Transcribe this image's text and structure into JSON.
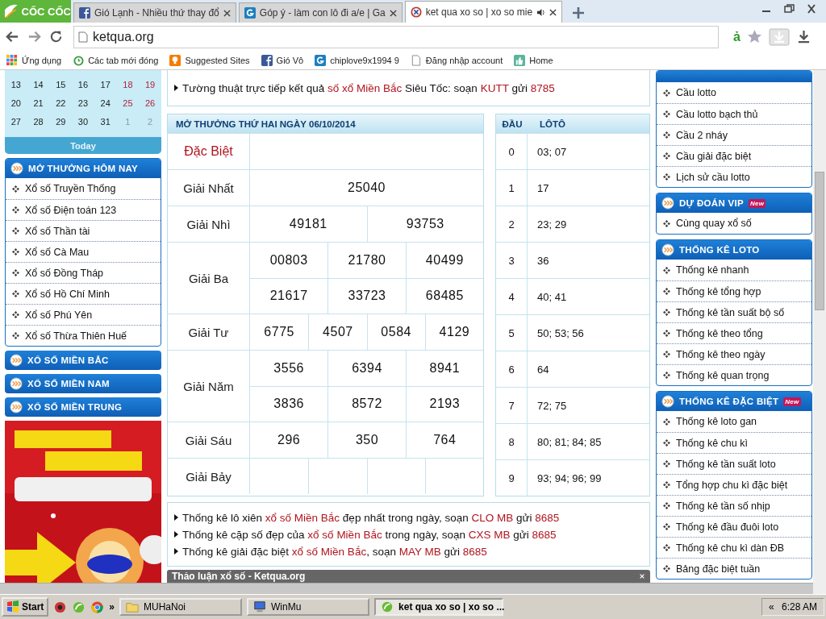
{
  "browser": {
    "logo": "CỐC CỐC",
    "tabs": [
      {
        "title": "Gió Lạnh - Nhiều thứ thay đổ",
        "selected": false,
        "audio": false
      },
      {
        "title": "Góp ý - làm con lô đi a/e | Ga",
        "selected": false,
        "audio": false
      },
      {
        "title": "ket qua xo so | xo so mie",
        "selected": true,
        "audio": true
      }
    ],
    "address": "ketqua.org",
    "extension": "ả",
    "bookmarks": [
      "Ứng dụng",
      "Các tab mới đóng",
      "Suggested Sites",
      "Gió Vô",
      "chiplove9x1994 9",
      "Đăng nhập account",
      "Home"
    ]
  },
  "left": {
    "calendar": [
      [
        {
          "text": "13",
          "kind": "day"
        },
        {
          "text": "14",
          "kind": "day"
        },
        {
          "text": "15",
          "kind": "day"
        },
        {
          "text": "16",
          "kind": "day"
        },
        {
          "text": "17",
          "kind": "day"
        },
        {
          "text": "18",
          "kind": "weekend"
        },
        {
          "text": "19",
          "kind": "weekend"
        }
      ],
      [
        {
          "text": "20",
          "kind": "day"
        },
        {
          "text": "21",
          "kind": "day"
        },
        {
          "text": "22",
          "kind": "day"
        },
        {
          "text": "23",
          "kind": "day"
        },
        {
          "text": "24",
          "kind": "day"
        },
        {
          "text": "25",
          "kind": "weekend"
        },
        {
          "text": "26",
          "kind": "weekend"
        }
      ],
      [
        {
          "text": "27",
          "kind": "day"
        },
        {
          "text": "28",
          "kind": "day"
        },
        {
          "text": "29",
          "kind": "day"
        },
        {
          "text": "30",
          "kind": "day"
        },
        {
          "text": "31",
          "kind": "day"
        },
        {
          "text": "1",
          "kind": "other"
        },
        {
          "text": "2",
          "kind": "other"
        }
      ]
    ],
    "today": "Today",
    "sections": [
      {
        "title": "MỞ THƯỞNG HÔM NAY",
        "expanded": true,
        "items": [
          "Xổ số Truyền Thống",
          "Xổ số Điện toán 123",
          "Xổ số Thần tài",
          "Xổ số Cà Mau",
          "Xổ số Đồng Tháp",
          "Xổ số Hồ Chí Minh",
          "Xổ số Phú Yên",
          "Xổ số Thừa Thiên Huế"
        ]
      },
      {
        "title": "XỔ SỐ MIỀN BẮC",
        "expanded": false
      },
      {
        "title": "XỔ SỐ MIỀN NAM",
        "expanded": false
      },
      {
        "title": "XỔ SỐ MIỀN TRUNG",
        "expanded": false
      }
    ],
    "banner": {
      "kind": "picture"
    }
  },
  "center": {
    "headline": [
      {
        "text": "Tường thuật trực tiếp kết quả ",
        "highlight": false
      },
      {
        "text": "số xổ Miền Bắc",
        "highlight": true
      },
      {
        "text": " Siêu Tốc: soạn ",
        "highlight": false
      },
      {
        "text": "KUTT",
        "highlight": true
      },
      {
        "text": " gửi ",
        "highlight": false
      },
      {
        "text": "8785",
        "highlight": true
      }
    ],
    "results_title": "MỞ THƯỞNG THỨ HAI NGÀY 06/10/2014",
    "prizes": [
      {
        "name": "Đặc Biệt",
        "kind": "special"
      },
      {
        "name": "Giải Nhất",
        "kind": "normal",
        "rows": [
          [
            "25040"
          ]
        ]
      },
      {
        "name": "Giải Nhì",
        "kind": "normal",
        "rows": [
          [
            "49181",
            "93753"
          ]
        ]
      },
      {
        "name": "Giải Ba",
        "kind": "normal",
        "rows": [
          [
            "00803",
            "21780",
            "40499"
          ],
          [
            "21617",
            "33723",
            "68485"
          ]
        ]
      },
      {
        "name": "Giải Tư",
        "kind": "normal",
        "rows": [
          [
            "6775",
            "4507",
            "0584",
            "4129"
          ]
        ]
      },
      {
        "name": "Giải Năm",
        "kind": "normal",
        "rows": [
          [
            "3556",
            "6394",
            "8941"
          ],
          [
            "3836",
            "8572",
            "2193"
          ]
        ]
      },
      {
        "name": "Giải Sáu",
        "kind": "normal",
        "rows": [
          [
            "296",
            "350",
            "764"
          ]
        ]
      },
      {
        "name": "Giải Bảy",
        "kind": "blank"
      }
    ],
    "loto": {
      "columns": [
        "ĐẦU",
        "LÔTÔ"
      ],
      "rows": [
        [
          "0",
          "03; 07"
        ],
        [
          "1",
          "17"
        ],
        [
          "2",
          "23; 29"
        ],
        [
          "3",
          "36"
        ],
        [
          "4",
          "40; 41"
        ],
        [
          "5",
          "50; 53; 56"
        ],
        [
          "6",
          "64"
        ],
        [
          "7",
          "72; 75"
        ],
        [
          "8",
          "80; 81; 84; 85"
        ],
        [
          "9",
          "93; 94; 96; 99"
        ]
      ]
    },
    "promos": [
      [
        {
          "text": "Thống kê lô xiên ",
          "highlight": false
        },
        {
          "text": "xổ số Miền Bắc",
          "highlight": true
        },
        {
          "text": " đẹp nhất trong ngày, soạn ",
          "highlight": false
        },
        {
          "text": "CLO MB",
          "highlight": true
        },
        {
          "text": " gửi ",
          "highlight": false
        },
        {
          "text": "8685",
          "highlight": true
        }
      ],
      [
        {
          "text": "Thống kê cặp số đẹp của ",
          "highlight": false
        },
        {
          "text": "xổ số Miền Bắc",
          "highlight": true
        },
        {
          "text": " trong ngày, soạn ",
          "highlight": false
        },
        {
          "text": "CXS MB",
          "highlight": true
        },
        {
          "text": " gửi ",
          "highlight": false
        },
        {
          "text": "8685",
          "highlight": true
        }
      ],
      [
        {
          "text": "Thống kê giải đặc biệt ",
          "highlight": false
        },
        {
          "text": "xổ số Miền Bắc",
          "highlight": true
        },
        {
          "text": ", soạn ",
          "highlight": false
        },
        {
          "text": "MAY MB",
          "highlight": true
        },
        {
          "text": " gửi ",
          "highlight": false
        },
        {
          "text": "8685",
          "highlight": true
        }
      ]
    ],
    "discussion_title": "Thảo luận xổ số - Ketqua.org"
  },
  "right": {
    "sections": [
      {
        "items": [
          "Cầu lotto",
          "Cầu lotto bạch thủ",
          "Cầu 2 nháy",
          "Cầu giải đặc biệt",
          "Lịch sử cầu lotto"
        ]
      },
      {
        "title": "DỰ ĐOÁN VIP",
        "badge": "New",
        "items": [
          "Cùng quay xổ số"
        ]
      },
      {
        "title": "THỐNG KÊ LOTO",
        "items": [
          "Thống kê nhanh",
          "Thống kê tổng hợp",
          "Thống kê tần suất bộ số",
          "Thống kê theo tổng",
          "Thống kê theo ngày",
          "Thống kê quan trọng"
        ]
      },
      {
        "title": "THỐNG KÊ ĐẶC BIỆT",
        "badge": "New",
        "items": [
          "Thống kê loto gan",
          "Thống kê chu kì",
          "Thống kê tần suất loto",
          "Tổng hợp chu kì đặc biệt",
          "Thống kê tần số nhịp",
          "Thống kê đầu đuôi loto",
          "Thống kê chu kì dàn ĐB",
          "Bảng đặc biệt tuần"
        ]
      }
    ]
  },
  "taskbar": {
    "start": "Start",
    "more": "»",
    "tasks": [
      {
        "label": "MUHaNoi",
        "selected": false
      },
      {
        "label": "WinMu",
        "selected": false
      },
      {
        "label": "ket qua xo so | xo so ...",
        "selected": true
      }
    ],
    "tray_toggle": "«",
    "clock": "6:28 AM"
  }
}
